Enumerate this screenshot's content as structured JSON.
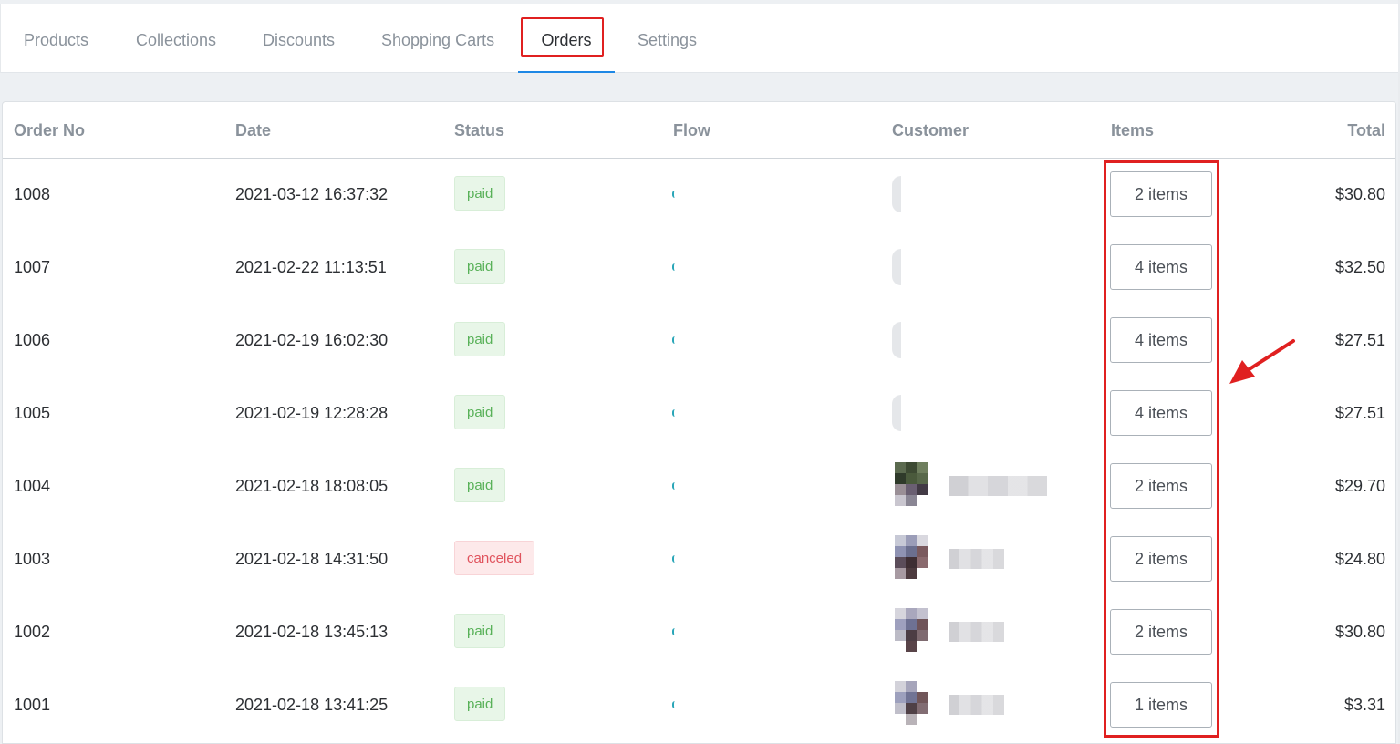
{
  "tabs": [
    {
      "label": "Products",
      "active": false
    },
    {
      "label": "Collections",
      "active": false
    },
    {
      "label": "Discounts",
      "active": false
    },
    {
      "label": "Shopping Carts",
      "active": false
    },
    {
      "label": "Orders",
      "active": true
    },
    {
      "label": "Settings",
      "active": false
    }
  ],
  "table": {
    "headers": {
      "order_no": "Order No",
      "date": "Date",
      "status": "Status",
      "flow": "Flow",
      "customer": "Customer",
      "items": "Items",
      "total": "Total"
    },
    "rows": [
      {
        "order_no": "1008",
        "date": "2021-03-12 16:37:32",
        "status": "paid",
        "items": "2 items",
        "total": "$30.80"
      },
      {
        "order_no": "1007",
        "date": "2021-02-22 11:13:51",
        "status": "paid",
        "items": "4 items",
        "total": "$32.50"
      },
      {
        "order_no": "1006",
        "date": "2021-02-19 16:02:30",
        "status": "paid",
        "items": "4 items",
        "total": "$27.51"
      },
      {
        "order_no": "1005",
        "date": "2021-02-19 12:28:28",
        "status": "paid",
        "items": "4 items",
        "total": "$27.51"
      },
      {
        "order_no": "1004",
        "date": "2021-02-18 18:08:05",
        "status": "paid",
        "items": "2 items",
        "total": "$29.70"
      },
      {
        "order_no": "1003",
        "date": "2021-02-18 14:31:50",
        "status": "canceled",
        "items": "2 items",
        "total": "$24.80"
      },
      {
        "order_no": "1002",
        "date": "2021-02-18 13:45:13",
        "status": "paid",
        "items": "2 items",
        "total": "$30.80"
      },
      {
        "order_no": "1001",
        "date": "2021-02-18 13:41:25",
        "status": "paid",
        "items": "1 items",
        "total": "$3.31"
      }
    ]
  },
  "colors": {
    "accent_underline": "#1e88e5",
    "annotation_red": "#e02020",
    "paid_text": "#58b158",
    "canceled_text": "#e0535d"
  },
  "annotations": {
    "arrow_icon": "red-arrow-icon"
  }
}
